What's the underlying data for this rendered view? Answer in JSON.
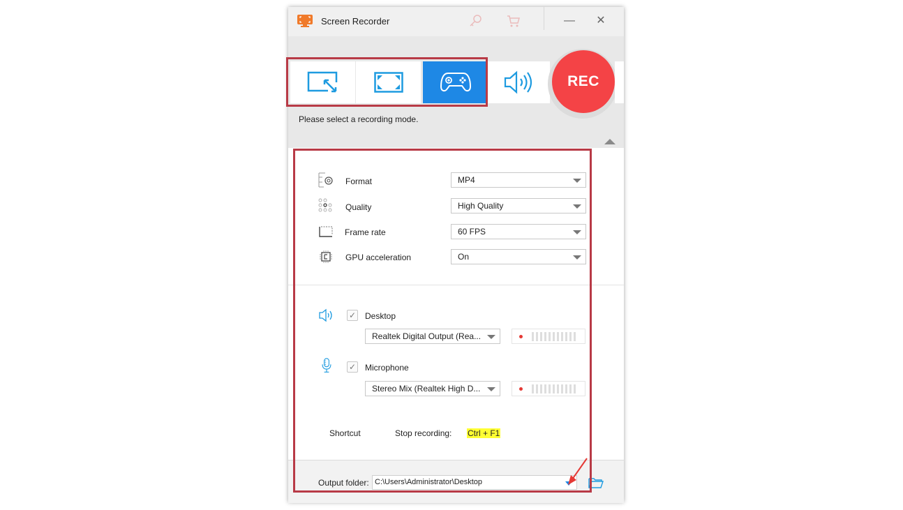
{
  "window": {
    "title": "Screen Recorder",
    "icons": [
      "app-logo-icon",
      "key-icon",
      "cart-icon"
    ],
    "controls": {
      "minimize": "—",
      "close": "✕"
    }
  },
  "modes": {
    "items": [
      {
        "name": "region",
        "icon": "region-resize-icon",
        "active": false
      },
      {
        "name": "fullscreen",
        "icon": "fullscreen-icon",
        "active": false
      },
      {
        "name": "game",
        "icon": "gamepad-icon",
        "active": true
      },
      {
        "name": "audio-only",
        "icon": "speaker-icon",
        "active": false
      }
    ],
    "rec_label": "REC",
    "hint": "Please select a recording mode.",
    "accent": "#1e88e5",
    "rec_color": "#f44346"
  },
  "settings": {
    "format": {
      "label": "Format",
      "value": "MP4",
      "icon": "format-gear-icon"
    },
    "quality": {
      "label": "Quality",
      "value": "High Quality",
      "icon": "quality-dots-icon"
    },
    "frame_rate": {
      "label": "Frame rate",
      "value": "60 FPS",
      "icon": "frame-icon"
    },
    "gpu": {
      "label": "GPU acceleration",
      "value": "On",
      "icon": "chip-icon"
    }
  },
  "audio": {
    "desktop": {
      "label": "Desktop",
      "checked": true,
      "device": "Realtek Digital Output (Rea...",
      "icon": "speaker-icon"
    },
    "microphone": {
      "label": "Microphone",
      "checked": true,
      "device": "Stereo Mix (Realtek High D...",
      "icon": "microphone-icon"
    },
    "check_glyph": "✓"
  },
  "shortcut": {
    "label": "Shortcut",
    "action": "Stop recording:",
    "keys": "Ctrl + F1"
  },
  "output": {
    "label": "Output folder:",
    "path": "C:\\Users\\Administrator\\Desktop"
  }
}
